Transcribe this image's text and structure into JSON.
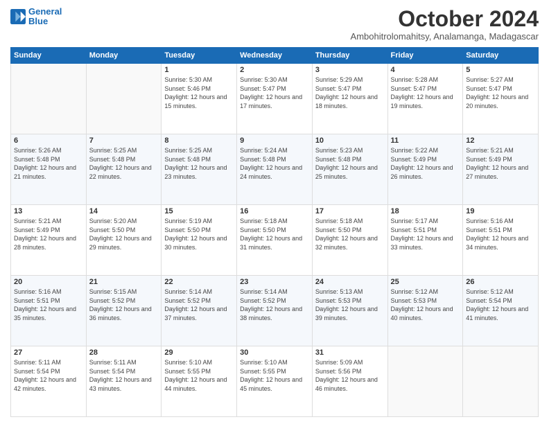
{
  "logo": {
    "line1": "General",
    "line2": "Blue"
  },
  "title": "October 2024",
  "location": "Ambohitrolomahitsy, Analamanga, Madagascar",
  "weekdays": [
    "Sunday",
    "Monday",
    "Tuesday",
    "Wednesday",
    "Thursday",
    "Friday",
    "Saturday"
  ],
  "weeks": [
    [
      {
        "day": "",
        "info": ""
      },
      {
        "day": "",
        "info": ""
      },
      {
        "day": "1",
        "info": "Sunrise: 5:30 AM\nSunset: 5:46 PM\nDaylight: 12 hours and 15 minutes."
      },
      {
        "day": "2",
        "info": "Sunrise: 5:30 AM\nSunset: 5:47 PM\nDaylight: 12 hours and 17 minutes."
      },
      {
        "day": "3",
        "info": "Sunrise: 5:29 AM\nSunset: 5:47 PM\nDaylight: 12 hours and 18 minutes."
      },
      {
        "day": "4",
        "info": "Sunrise: 5:28 AM\nSunset: 5:47 PM\nDaylight: 12 hours and 19 minutes."
      },
      {
        "day": "5",
        "info": "Sunrise: 5:27 AM\nSunset: 5:47 PM\nDaylight: 12 hours and 20 minutes."
      }
    ],
    [
      {
        "day": "6",
        "info": "Sunrise: 5:26 AM\nSunset: 5:48 PM\nDaylight: 12 hours and 21 minutes."
      },
      {
        "day": "7",
        "info": "Sunrise: 5:25 AM\nSunset: 5:48 PM\nDaylight: 12 hours and 22 minutes."
      },
      {
        "day": "8",
        "info": "Sunrise: 5:25 AM\nSunset: 5:48 PM\nDaylight: 12 hours and 23 minutes."
      },
      {
        "day": "9",
        "info": "Sunrise: 5:24 AM\nSunset: 5:48 PM\nDaylight: 12 hours and 24 minutes."
      },
      {
        "day": "10",
        "info": "Sunrise: 5:23 AM\nSunset: 5:48 PM\nDaylight: 12 hours and 25 minutes."
      },
      {
        "day": "11",
        "info": "Sunrise: 5:22 AM\nSunset: 5:49 PM\nDaylight: 12 hours and 26 minutes."
      },
      {
        "day": "12",
        "info": "Sunrise: 5:21 AM\nSunset: 5:49 PM\nDaylight: 12 hours and 27 minutes."
      }
    ],
    [
      {
        "day": "13",
        "info": "Sunrise: 5:21 AM\nSunset: 5:49 PM\nDaylight: 12 hours and 28 minutes."
      },
      {
        "day": "14",
        "info": "Sunrise: 5:20 AM\nSunset: 5:50 PM\nDaylight: 12 hours and 29 minutes."
      },
      {
        "day": "15",
        "info": "Sunrise: 5:19 AM\nSunset: 5:50 PM\nDaylight: 12 hours and 30 minutes."
      },
      {
        "day": "16",
        "info": "Sunrise: 5:18 AM\nSunset: 5:50 PM\nDaylight: 12 hours and 31 minutes."
      },
      {
        "day": "17",
        "info": "Sunrise: 5:18 AM\nSunset: 5:50 PM\nDaylight: 12 hours and 32 minutes."
      },
      {
        "day": "18",
        "info": "Sunrise: 5:17 AM\nSunset: 5:51 PM\nDaylight: 12 hours and 33 minutes."
      },
      {
        "day": "19",
        "info": "Sunrise: 5:16 AM\nSunset: 5:51 PM\nDaylight: 12 hours and 34 minutes."
      }
    ],
    [
      {
        "day": "20",
        "info": "Sunrise: 5:16 AM\nSunset: 5:51 PM\nDaylight: 12 hours and 35 minutes."
      },
      {
        "day": "21",
        "info": "Sunrise: 5:15 AM\nSunset: 5:52 PM\nDaylight: 12 hours and 36 minutes."
      },
      {
        "day": "22",
        "info": "Sunrise: 5:14 AM\nSunset: 5:52 PM\nDaylight: 12 hours and 37 minutes."
      },
      {
        "day": "23",
        "info": "Sunrise: 5:14 AM\nSunset: 5:52 PM\nDaylight: 12 hours and 38 minutes."
      },
      {
        "day": "24",
        "info": "Sunrise: 5:13 AM\nSunset: 5:53 PM\nDaylight: 12 hours and 39 minutes."
      },
      {
        "day": "25",
        "info": "Sunrise: 5:12 AM\nSunset: 5:53 PM\nDaylight: 12 hours and 40 minutes."
      },
      {
        "day": "26",
        "info": "Sunrise: 5:12 AM\nSunset: 5:54 PM\nDaylight: 12 hours and 41 minutes."
      }
    ],
    [
      {
        "day": "27",
        "info": "Sunrise: 5:11 AM\nSunset: 5:54 PM\nDaylight: 12 hours and 42 minutes."
      },
      {
        "day": "28",
        "info": "Sunrise: 5:11 AM\nSunset: 5:54 PM\nDaylight: 12 hours and 43 minutes."
      },
      {
        "day": "29",
        "info": "Sunrise: 5:10 AM\nSunset: 5:55 PM\nDaylight: 12 hours and 44 minutes."
      },
      {
        "day": "30",
        "info": "Sunrise: 5:10 AM\nSunset: 5:55 PM\nDaylight: 12 hours and 45 minutes."
      },
      {
        "day": "31",
        "info": "Sunrise: 5:09 AM\nSunset: 5:56 PM\nDaylight: 12 hours and 46 minutes."
      },
      {
        "day": "",
        "info": ""
      },
      {
        "day": "",
        "info": ""
      }
    ]
  ]
}
